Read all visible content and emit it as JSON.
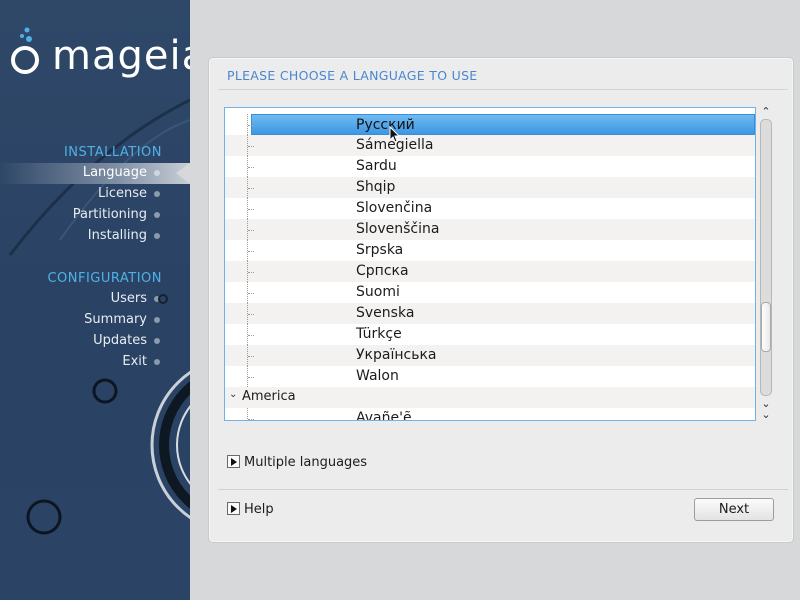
{
  "brand": {
    "name": "mageia"
  },
  "sidebar": {
    "sections": [
      {
        "title": "INSTALLATION",
        "steps": [
          {
            "label": "Language",
            "state": "active"
          },
          {
            "label": "License",
            "state": "pending"
          },
          {
            "label": "Partitioning",
            "state": "pending"
          },
          {
            "label": "Installing",
            "state": "pending"
          }
        ]
      },
      {
        "title": "CONFIGURATION",
        "steps": [
          {
            "label": "Users",
            "state": "ring"
          },
          {
            "label": "Summary",
            "state": "pending"
          },
          {
            "label": "Updates",
            "state": "pending"
          },
          {
            "label": "Exit",
            "state": "pending"
          }
        ]
      }
    ]
  },
  "panel": {
    "title": "PLEASE CHOOSE A LANGUAGE TO USE",
    "languages": [
      {
        "label": "Русский",
        "selected": true
      },
      {
        "label": "Sámegiella"
      },
      {
        "label": "Sardu"
      },
      {
        "label": "Shqip"
      },
      {
        "label": "Slovenčina"
      },
      {
        "label": "Slovenščina"
      },
      {
        "label": "Srpska"
      },
      {
        "label": "Српска"
      },
      {
        "label": "Suomi"
      },
      {
        "label": "Svenska"
      },
      {
        "label": "Türkçe"
      },
      {
        "label": "Українська"
      },
      {
        "label": "Walon"
      }
    ],
    "group": {
      "label": "America",
      "expanded": true
    },
    "group_first_item": "Avañe'ẽ",
    "multiple_languages_label": "Multiple languages",
    "help_label": "Help",
    "next_label": "Next"
  },
  "colors": {
    "accent": "#4fb2e6",
    "selection": "#3d97e2",
    "sidebar_bg": "#2b4466"
  },
  "icons": [
    "chevron-up-icon",
    "chevron-down-icon",
    "expander-arrow-icon",
    "mouse-cursor-icon"
  ]
}
